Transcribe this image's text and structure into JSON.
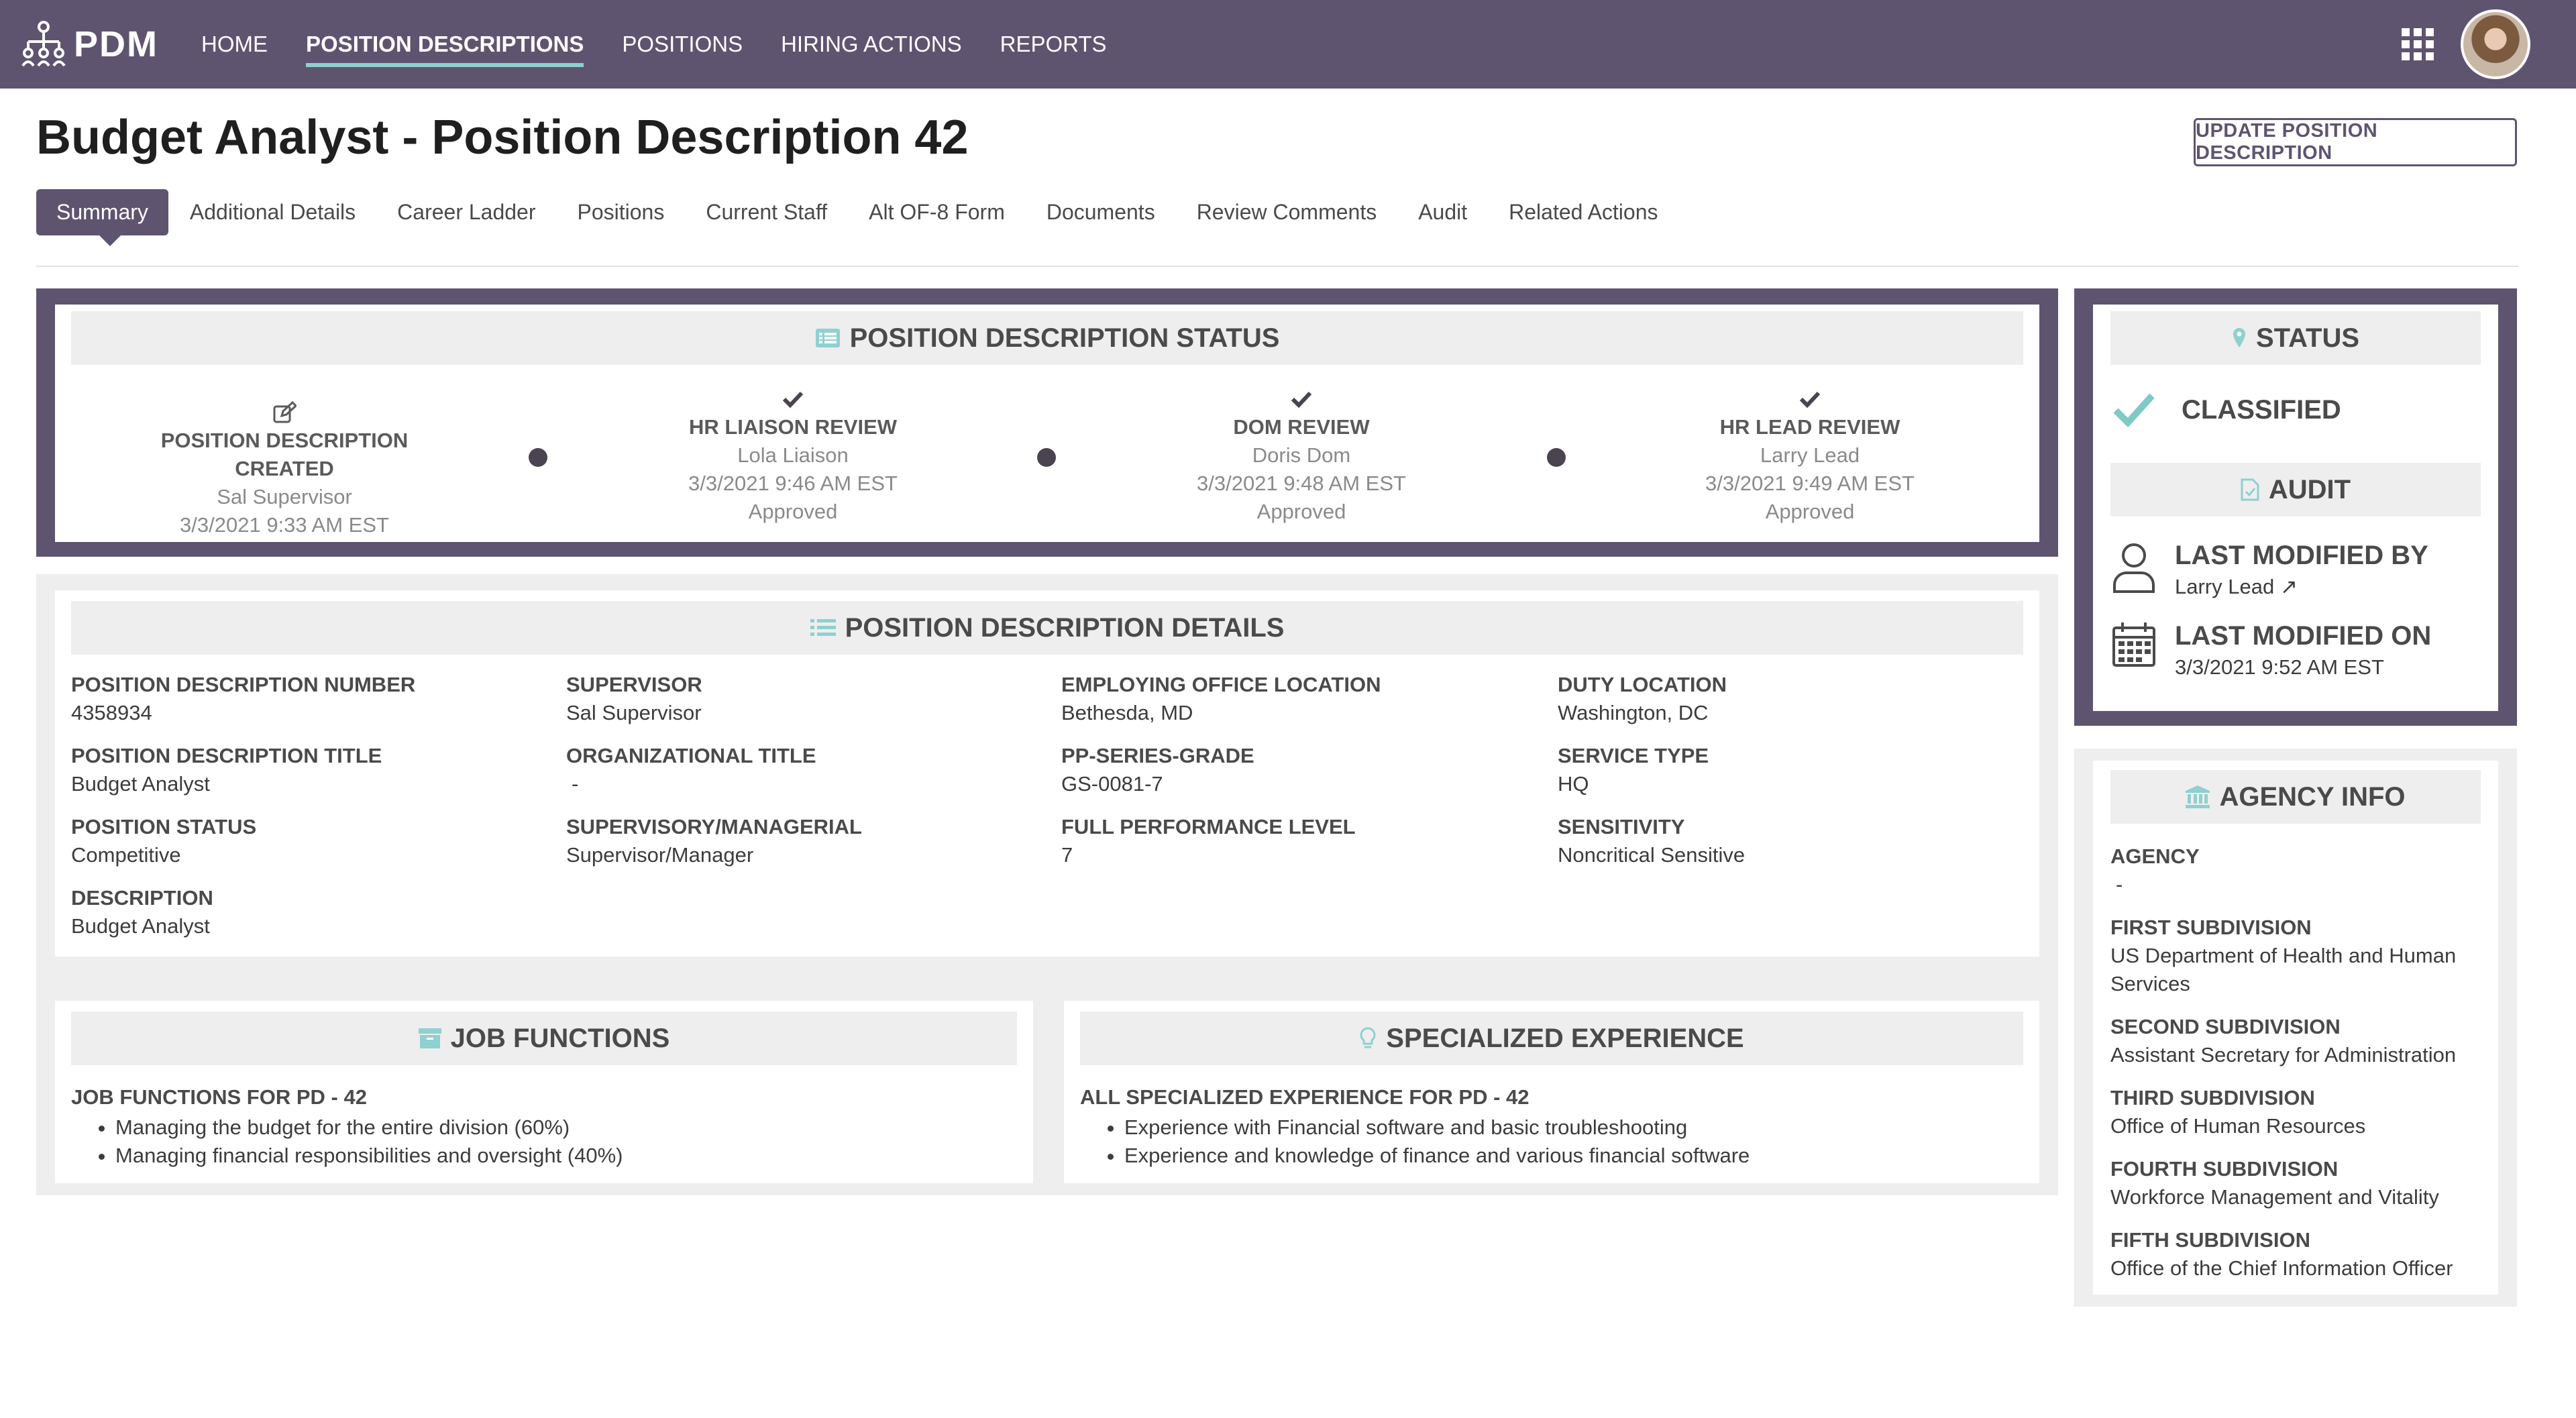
{
  "app": {
    "logo_text": "PDM"
  },
  "nav": {
    "items": [
      "HOME",
      "POSITION DESCRIPTIONS",
      "POSITIONS",
      "HIRING ACTIONS",
      "REPORTS"
    ],
    "active_index": 1
  },
  "page": {
    "title": "Budget Analyst - Position Description 42",
    "update_button": "UPDATE POSITION DESCRIPTION"
  },
  "tabs": [
    "Summary",
    "Additional Details",
    "Career Ladder",
    "Positions",
    "Current Staff",
    "Alt OF-8 Form",
    "Documents",
    "Review Comments",
    "Audit",
    "Related Actions"
  ],
  "status_card": {
    "title": "POSITION DESCRIPTION STATUS",
    "steps": [
      {
        "icon": "edit-icon",
        "title": "POSITION DESCRIPTION CREATED",
        "person": "Sal Supervisor",
        "time": "3/3/2021 9:33 AM EST",
        "result": ""
      },
      {
        "icon": "check-icon",
        "title": "HR LIAISON REVIEW",
        "person": "Lola Liaison",
        "time": "3/3/2021 9:46 AM EST",
        "result": "Approved"
      },
      {
        "icon": "check-icon",
        "title": "DOM REVIEW",
        "person": "Doris Dom",
        "time": "3/3/2021 9:48 AM EST",
        "result": "Approved"
      },
      {
        "icon": "check-icon",
        "title": "HR LEAD REVIEW",
        "person": "Larry Lead",
        "time": "3/3/2021 9:49 AM EST",
        "result": "Approved"
      }
    ]
  },
  "details_card": {
    "title": "POSITION DESCRIPTION DETAILS",
    "fields": {
      "pd_number": {
        "label": "POSITION DESCRIPTION NUMBER",
        "value": "4358934"
      },
      "supervisor": {
        "label": "SUPERVISOR",
        "value": "Sal Supervisor"
      },
      "employing_office": {
        "label": "EMPLOYING OFFICE LOCATION",
        "value": "Bethesda, MD"
      },
      "duty_location": {
        "label": "DUTY LOCATION",
        "value": "Washington, DC"
      },
      "pd_title": {
        "label": "POSITION DESCRIPTION TITLE",
        "value": "Budget Analyst"
      },
      "org_title": {
        "label": "ORGANIZATIONAL TITLE",
        "value": "-"
      },
      "pp_series_grade": {
        "label": "PP-SERIES-GRADE",
        "value": "GS-0081-7"
      },
      "service_type": {
        "label": "SERVICE TYPE",
        "value": "HQ"
      },
      "position_status": {
        "label": "POSITION STATUS",
        "value": "Competitive"
      },
      "supervisory": {
        "label": "SUPERVISORY/MANAGERIAL",
        "value": "Supervisor/Manager"
      },
      "full_performance": {
        "label": "FULL PERFORMANCE LEVEL",
        "value": "7"
      },
      "sensitivity": {
        "label": "SENSITIVITY",
        "value": "Noncritical Sensitive"
      },
      "description": {
        "label": "DESCRIPTION",
        "value": "Budget Analyst"
      }
    }
  },
  "job_functions": {
    "title": "JOB FUNCTIONS",
    "subtitle": "JOB FUNCTIONS FOR PD - 42",
    "items": [
      "Managing the budget for the entire division (60%)",
      "Managing financial responsibilities and oversight (40%)"
    ]
  },
  "specialized_experience": {
    "title": "SPECIALIZED EXPERIENCE",
    "subtitle": "ALL SPECIALIZED EXPERIENCE FOR PD - 42",
    "items": [
      "Experience with Financial software and basic troubleshooting",
      "Experience and knowledge of finance and various financial software"
    ]
  },
  "status_panel": {
    "title": "STATUS",
    "value": "CLASSIFIED"
  },
  "audit_panel": {
    "title": "AUDIT",
    "modified_by_label": "LAST MODIFIED BY",
    "modified_by_value": "Larry Lead",
    "modified_on_label": "LAST MODIFIED ON",
    "modified_on_value": "3/3/2021 9:52 AM EST"
  },
  "agency_info": {
    "title": "AGENCY INFO",
    "fields": [
      {
        "label": "AGENCY",
        "value": "-"
      },
      {
        "label": "FIRST SUBDIVISION",
        "value": "US Department of Health and Human Services"
      },
      {
        "label": "SECOND SUBDIVISION",
        "value": "Assistant Secretary for Administration"
      },
      {
        "label": "THIRD SUBDIVISION",
        "value": "Office of Human Resources"
      },
      {
        "label": "FOURTH SUBDIVISION",
        "value": "Workforce Management and Vitality"
      },
      {
        "label": "FIFTH SUBDIVISION",
        "value": "Office of the Chief Information Officer"
      }
    ]
  },
  "colors": {
    "brand": "#5f5470",
    "accent": "#8fd0d0",
    "panel": "#eeeeee"
  }
}
